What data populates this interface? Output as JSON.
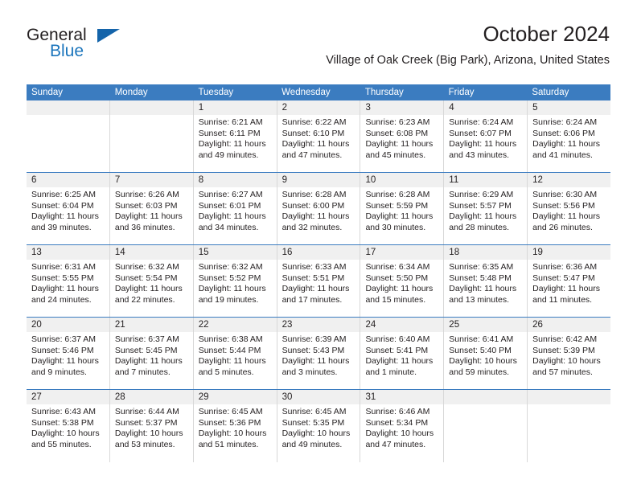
{
  "brand": {
    "name_primary": "General",
    "name_secondary": "Blue"
  },
  "header": {
    "title": "October 2024",
    "subtitle": "Village of Oak Creek (Big Park), Arizona, United States"
  },
  "colors": {
    "header_blue": "#3b7cc0",
    "brand_blue": "#1b75bc",
    "daynum_band": "#f0f0f0",
    "text": "#231f20"
  },
  "calendar": {
    "weekdays": [
      "Sunday",
      "Monday",
      "Tuesday",
      "Wednesday",
      "Thursday",
      "Friday",
      "Saturday"
    ],
    "weeks": [
      [
        {
          "day": "",
          "empty": true
        },
        {
          "day": "",
          "empty": true
        },
        {
          "day": "1",
          "sunrise": "Sunrise: 6:21 AM",
          "sunset": "Sunset: 6:11 PM",
          "daylight1": "Daylight: 11 hours",
          "daylight2": "and 49 minutes."
        },
        {
          "day": "2",
          "sunrise": "Sunrise: 6:22 AM",
          "sunset": "Sunset: 6:10 PM",
          "daylight1": "Daylight: 11 hours",
          "daylight2": "and 47 minutes."
        },
        {
          "day": "3",
          "sunrise": "Sunrise: 6:23 AM",
          "sunset": "Sunset: 6:08 PM",
          "daylight1": "Daylight: 11 hours",
          "daylight2": "and 45 minutes."
        },
        {
          "day": "4",
          "sunrise": "Sunrise: 6:24 AM",
          "sunset": "Sunset: 6:07 PM",
          "daylight1": "Daylight: 11 hours",
          "daylight2": "and 43 minutes."
        },
        {
          "day": "5",
          "sunrise": "Sunrise: 6:24 AM",
          "sunset": "Sunset: 6:06 PM",
          "daylight1": "Daylight: 11 hours",
          "daylight2": "and 41 minutes."
        }
      ],
      [
        {
          "day": "6",
          "sunrise": "Sunrise: 6:25 AM",
          "sunset": "Sunset: 6:04 PM",
          "daylight1": "Daylight: 11 hours",
          "daylight2": "and 39 minutes."
        },
        {
          "day": "7",
          "sunrise": "Sunrise: 6:26 AM",
          "sunset": "Sunset: 6:03 PM",
          "daylight1": "Daylight: 11 hours",
          "daylight2": "and 36 minutes."
        },
        {
          "day": "8",
          "sunrise": "Sunrise: 6:27 AM",
          "sunset": "Sunset: 6:01 PM",
          "daylight1": "Daylight: 11 hours",
          "daylight2": "and 34 minutes."
        },
        {
          "day": "9",
          "sunrise": "Sunrise: 6:28 AM",
          "sunset": "Sunset: 6:00 PM",
          "daylight1": "Daylight: 11 hours",
          "daylight2": "and 32 minutes."
        },
        {
          "day": "10",
          "sunrise": "Sunrise: 6:28 AM",
          "sunset": "Sunset: 5:59 PM",
          "daylight1": "Daylight: 11 hours",
          "daylight2": "and 30 minutes."
        },
        {
          "day": "11",
          "sunrise": "Sunrise: 6:29 AM",
          "sunset": "Sunset: 5:57 PM",
          "daylight1": "Daylight: 11 hours",
          "daylight2": "and 28 minutes."
        },
        {
          "day": "12",
          "sunrise": "Sunrise: 6:30 AM",
          "sunset": "Sunset: 5:56 PM",
          "daylight1": "Daylight: 11 hours",
          "daylight2": "and 26 minutes."
        }
      ],
      [
        {
          "day": "13",
          "sunrise": "Sunrise: 6:31 AM",
          "sunset": "Sunset: 5:55 PM",
          "daylight1": "Daylight: 11 hours",
          "daylight2": "and 24 minutes."
        },
        {
          "day": "14",
          "sunrise": "Sunrise: 6:32 AM",
          "sunset": "Sunset: 5:54 PM",
          "daylight1": "Daylight: 11 hours",
          "daylight2": "and 22 minutes."
        },
        {
          "day": "15",
          "sunrise": "Sunrise: 6:32 AM",
          "sunset": "Sunset: 5:52 PM",
          "daylight1": "Daylight: 11 hours",
          "daylight2": "and 19 minutes."
        },
        {
          "day": "16",
          "sunrise": "Sunrise: 6:33 AM",
          "sunset": "Sunset: 5:51 PM",
          "daylight1": "Daylight: 11 hours",
          "daylight2": "and 17 minutes."
        },
        {
          "day": "17",
          "sunrise": "Sunrise: 6:34 AM",
          "sunset": "Sunset: 5:50 PM",
          "daylight1": "Daylight: 11 hours",
          "daylight2": "and 15 minutes."
        },
        {
          "day": "18",
          "sunrise": "Sunrise: 6:35 AM",
          "sunset": "Sunset: 5:48 PM",
          "daylight1": "Daylight: 11 hours",
          "daylight2": "and 13 minutes."
        },
        {
          "day": "19",
          "sunrise": "Sunrise: 6:36 AM",
          "sunset": "Sunset: 5:47 PM",
          "daylight1": "Daylight: 11 hours",
          "daylight2": "and 11 minutes."
        }
      ],
      [
        {
          "day": "20",
          "sunrise": "Sunrise: 6:37 AM",
          "sunset": "Sunset: 5:46 PM",
          "daylight1": "Daylight: 11 hours",
          "daylight2": "and 9 minutes."
        },
        {
          "day": "21",
          "sunrise": "Sunrise: 6:37 AM",
          "sunset": "Sunset: 5:45 PM",
          "daylight1": "Daylight: 11 hours",
          "daylight2": "and 7 minutes."
        },
        {
          "day": "22",
          "sunrise": "Sunrise: 6:38 AM",
          "sunset": "Sunset: 5:44 PM",
          "daylight1": "Daylight: 11 hours",
          "daylight2": "and 5 minutes."
        },
        {
          "day": "23",
          "sunrise": "Sunrise: 6:39 AM",
          "sunset": "Sunset: 5:43 PM",
          "daylight1": "Daylight: 11 hours",
          "daylight2": "and 3 minutes."
        },
        {
          "day": "24",
          "sunrise": "Sunrise: 6:40 AM",
          "sunset": "Sunset: 5:41 PM",
          "daylight1": "Daylight: 11 hours",
          "daylight2": "and 1 minute."
        },
        {
          "day": "25",
          "sunrise": "Sunrise: 6:41 AM",
          "sunset": "Sunset: 5:40 PM",
          "daylight1": "Daylight: 10 hours",
          "daylight2": "and 59 minutes."
        },
        {
          "day": "26",
          "sunrise": "Sunrise: 6:42 AM",
          "sunset": "Sunset: 5:39 PM",
          "daylight1": "Daylight: 10 hours",
          "daylight2": "and 57 minutes."
        }
      ],
      [
        {
          "day": "27",
          "sunrise": "Sunrise: 6:43 AM",
          "sunset": "Sunset: 5:38 PM",
          "daylight1": "Daylight: 10 hours",
          "daylight2": "and 55 minutes."
        },
        {
          "day": "28",
          "sunrise": "Sunrise: 6:44 AM",
          "sunset": "Sunset: 5:37 PM",
          "daylight1": "Daylight: 10 hours",
          "daylight2": "and 53 minutes."
        },
        {
          "day": "29",
          "sunrise": "Sunrise: 6:45 AM",
          "sunset": "Sunset: 5:36 PM",
          "daylight1": "Daylight: 10 hours",
          "daylight2": "and 51 minutes."
        },
        {
          "day": "30",
          "sunrise": "Sunrise: 6:45 AM",
          "sunset": "Sunset: 5:35 PM",
          "daylight1": "Daylight: 10 hours",
          "daylight2": "and 49 minutes."
        },
        {
          "day": "31",
          "sunrise": "Sunrise: 6:46 AM",
          "sunset": "Sunset: 5:34 PM",
          "daylight1": "Daylight: 10 hours",
          "daylight2": "and 47 minutes."
        },
        {
          "day": "",
          "empty": true
        },
        {
          "day": "",
          "empty": true
        }
      ]
    ]
  }
}
